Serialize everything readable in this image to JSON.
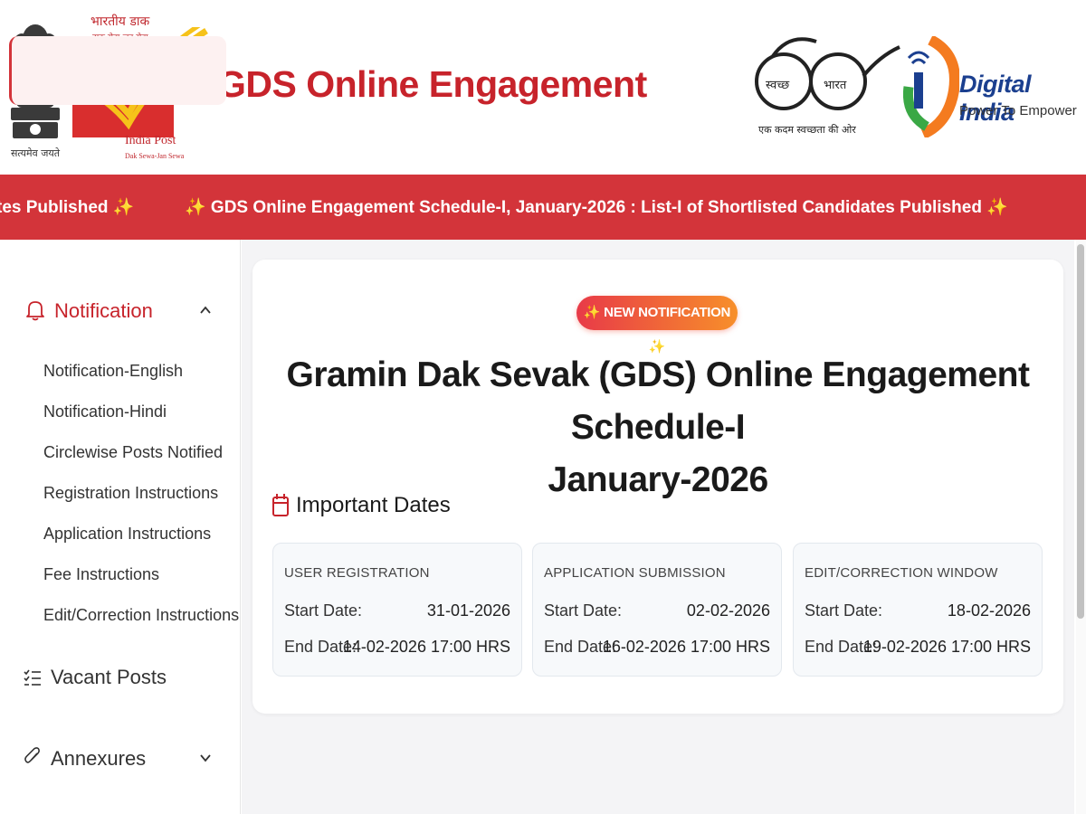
{
  "header": {
    "emblem_caption": "सत्यमेव जयते",
    "indiapost": {
      "hindi_name": "भारतीय डाक",
      "hindi_tagline": "डाक सेवा-जन सेवा",
      "name": "India Post",
      "tagline": "Dak Sewa-Jan Sewa"
    },
    "title": "GDS Online Engagement",
    "swachh": {
      "left_text": "स्वच्छ",
      "right_text": "भारत",
      "caption": "एक कदम स्वच्छता की ओर"
    },
    "digital_india": {
      "title": "Digital India",
      "tagline": "Power To Empower"
    }
  },
  "ticker": {
    "items": [
      "tes Published ✨",
      "✨ GDS Online Engagement Schedule-I, January-2026 : List-I of Shortlisted Candidates Published ✨"
    ]
  },
  "sidebar": {
    "active": {
      "label": "Notification",
      "icon": "bell-icon"
    },
    "sub_items": [
      "Notification-English",
      "Notification-Hindi",
      "Circlewise Posts Notified",
      "Registration Instructions",
      "Application Instructions",
      "Fee Instructions",
      "Edit/Correction Instructions"
    ],
    "items": [
      {
        "label": "Vacant Posts",
        "icon": "checklist-icon"
      },
      {
        "label": "Annexures",
        "icon": "paperclip-icon"
      }
    ]
  },
  "main": {
    "badge": "✨ NEW NOTIFICATION ✨",
    "title_line1": "Gramin Dak Sevak (GDS) Online Engagement Schedule-I",
    "title_line2": "January-2026",
    "dates_heading": "Important Dates",
    "date_cards": [
      {
        "title": "USER REGISTRATION",
        "start_label": "Start Date:",
        "start_value": "31-01-2026",
        "end_label": "End Date:",
        "end_value": "14-02-2026 17:00 HRS"
      },
      {
        "title": "APPLICATION SUBMISSION",
        "start_label": "Start Date:",
        "start_value": "02-02-2026",
        "end_label": "End Date:",
        "end_value": "16-02-2026 17:00 HRS"
      },
      {
        "title": "EDIT/CORRECTION WINDOW",
        "start_label": "Start Date:",
        "start_value": "18-02-2026",
        "end_label": "End Date:",
        "end_value": "19-02-2026 17:00 HRS"
      }
    ]
  },
  "colors": {
    "brand_red": "#c7232b",
    "ticker_red": "#d3343a",
    "badge_gradient_start": "#e83a48",
    "badge_gradient_end": "#f78f2a",
    "digital_india_blue": "#1b3f8f"
  }
}
